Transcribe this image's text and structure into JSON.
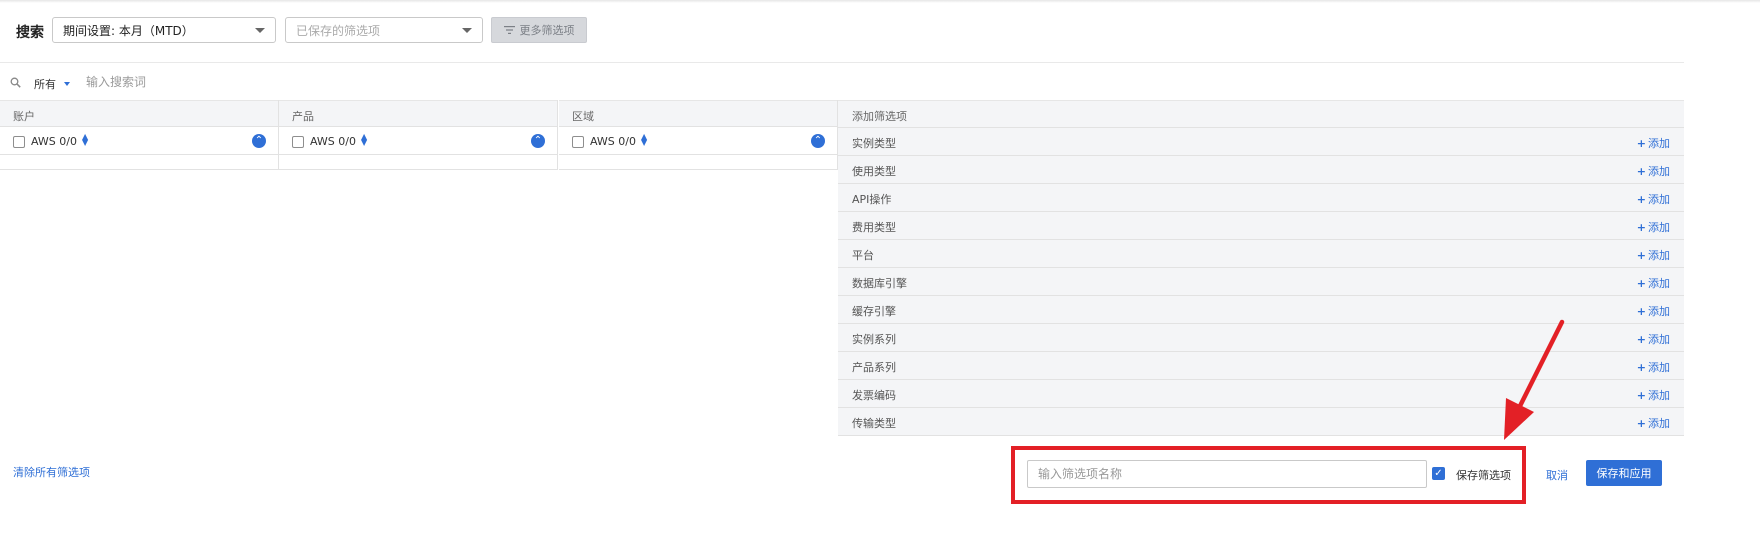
{
  "header": {
    "search_label": "搜索",
    "period_select": "期间设置: 本月（MTD）",
    "saved_filters_placeholder": "已保存的筛选项",
    "more_filters_button": "更多筛选项"
  },
  "search": {
    "scope": "所有",
    "placeholder": "输入搜索词"
  },
  "columns": [
    {
      "header": "账户",
      "value": "AWS 0/0"
    },
    {
      "header": "产品",
      "value": "AWS 0/0"
    },
    {
      "header": "区域",
      "value": "AWS 0/0"
    }
  ],
  "add_filters": {
    "header": "添加筛选项",
    "add_label": "添加",
    "items": [
      "实例类型",
      "使用类型",
      "API操作",
      "费用类型",
      "平台",
      "数据库引擎",
      "缓存引擎",
      "实例系列",
      "产品系列",
      "发票编码",
      "传输类型"
    ]
  },
  "footer": {
    "clear_all": "清除所有筛选项",
    "filter_name_placeholder": "输入筛选项名称",
    "save_filter_label": "保存筛选项",
    "save_filter_checked": true,
    "cancel": "取消",
    "save_and_apply": "保存和应用"
  },
  "colors": {
    "accent": "#2f6fd6",
    "annotation_red": "#e32026"
  }
}
